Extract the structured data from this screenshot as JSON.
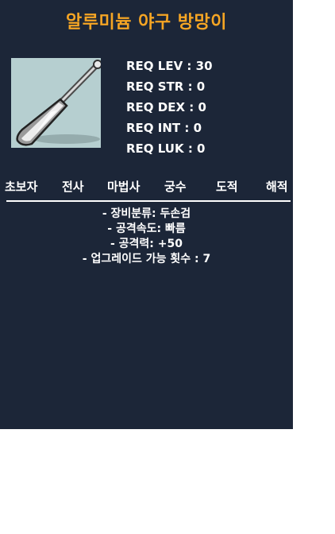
{
  "item": {
    "name": "알루미늄 야구 방망이",
    "name_color": "#f5a524",
    "icon": "aluminum-baseball-bat-icon"
  },
  "requirements": [
    "REQ LEV : 30",
    "REQ STR : 0",
    "REQ DEX : 0",
    "REQ INT : 0",
    "REQ LUK : 0"
  ],
  "jobs": [
    "초보자",
    "전사",
    "마법사",
    "궁수",
    "도적",
    "해적"
  ],
  "stats": [
    "- 장비분류: 두손검",
    "- 공격속도: 빠름",
    "- 공격력: +50",
    "- 업그레이드 가능 횟수 : 7"
  ]
}
